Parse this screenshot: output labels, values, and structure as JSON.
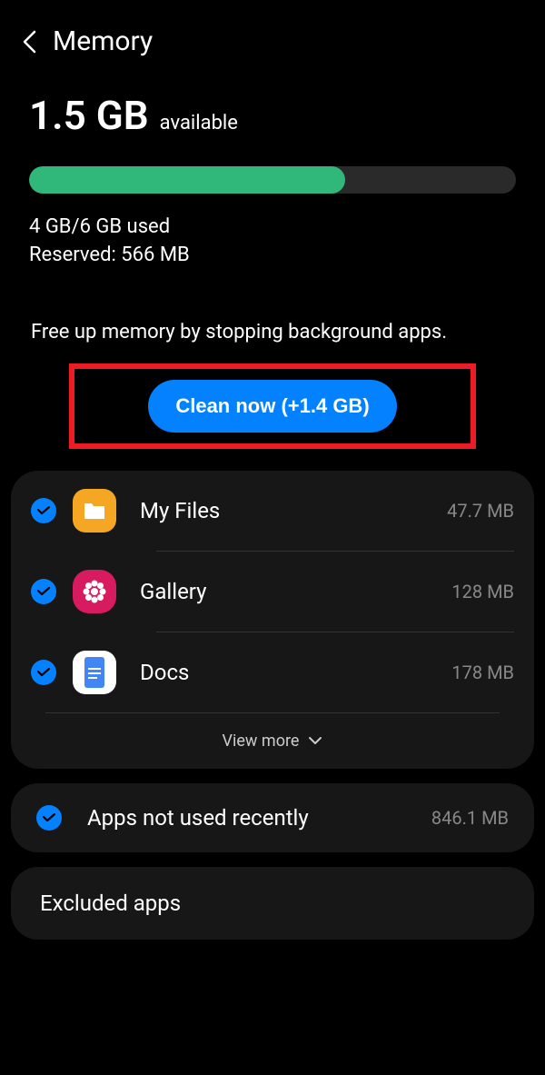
{
  "header": {
    "title": "Memory"
  },
  "memory": {
    "available_size": "1.5 GB",
    "available_label": "available",
    "usage_line": "4 GB/6 GB used",
    "reserved_line": "Reserved: 566 MB",
    "hint": "Free up memory by stopping background apps.",
    "clean_button": "Clean now (+1.4 GB)",
    "progress_percent": 65
  },
  "apps": [
    {
      "name": "My Files",
      "size": "47.7 MB"
    },
    {
      "name": "Gallery",
      "size": "128 MB"
    },
    {
      "name": "Docs",
      "size": "178 MB"
    }
  ],
  "view_more": "View more",
  "sections": {
    "apps_not_used": {
      "label": "Apps not used recently",
      "size": "846.1 MB"
    },
    "excluded": {
      "label": "Excluded apps"
    }
  }
}
